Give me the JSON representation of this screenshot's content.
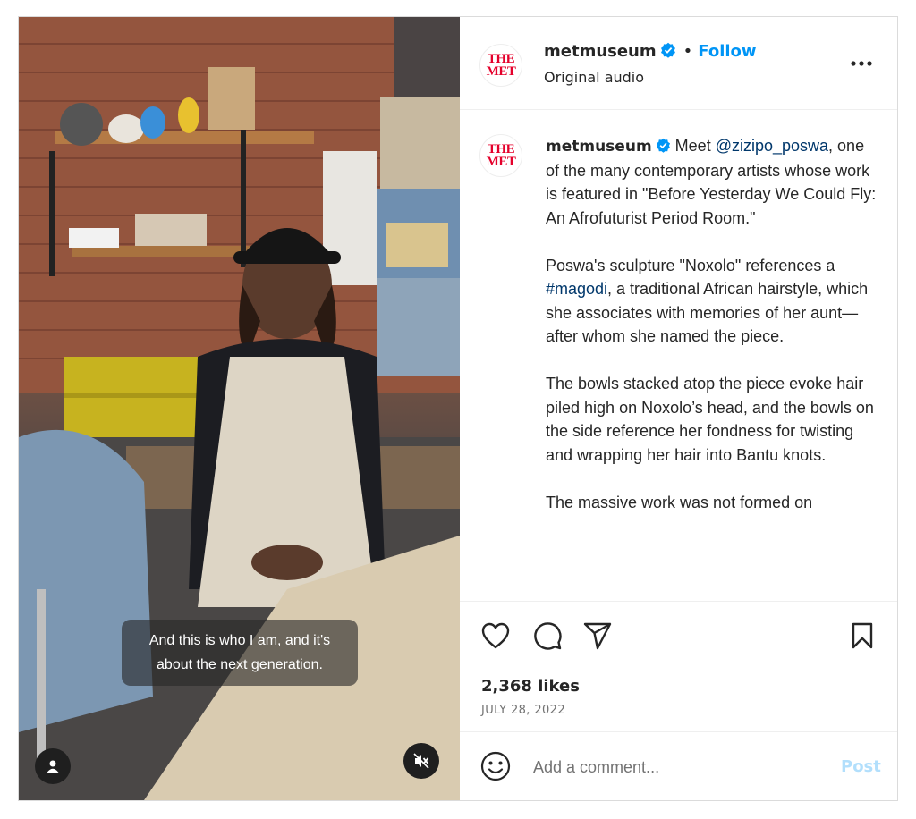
{
  "media": {
    "caption_line1": "And this is who I am, and it's",
    "caption_line2": "about the next generation."
  },
  "header": {
    "username": "metmuseum",
    "separator": "•",
    "follow_label": "Follow",
    "audio_label": "Original audio",
    "logo_line1": "THE",
    "logo_line2": "MET"
  },
  "post": {
    "username": "metmuseum",
    "text_before_mention": "Meet ",
    "mention": "@zizipo_poswa",
    "text_after_mention": ", one of the many contemporary artists whose work is featured in \"Before Yesterday We Could Fly: An Afrofuturist Period Room.\"",
    "para2_before_hashtag": "Poswa's sculpture \"Noxolo\" references a ",
    "hashtag": "#magodi",
    "para2_after_hashtag": ", a traditional African hairstyle, which she associates with memories of her aunt—after whom she named the piece.",
    "para3": "The bowls stacked atop the piece evoke hair piled high on Noxolo’s head, and the bowls on the side reference her fondness for twisting and wrapping her hair into Bantu knots.",
    "para4": "The massive work was not formed on"
  },
  "actions": {
    "likes": "2,368 likes",
    "date": "JULY 28, 2022"
  },
  "composer": {
    "placeholder": "Add a comment...",
    "post_label": "Post"
  },
  "icons": {
    "like": "heart-icon",
    "comment": "speech-bubble-icon",
    "share": "paper-plane-icon",
    "save": "bookmark-icon",
    "emoji": "smiley-icon",
    "more": "more-dots-icon",
    "verified": "verified-badge-icon",
    "profile": "user-icon",
    "mute": "speaker-muted-icon"
  },
  "colors": {
    "accent": "#0095f6",
    "link": "#00376b",
    "muted_text": "#737373",
    "post_disabled": "#b2dffc",
    "met_red": "#e4002b"
  }
}
